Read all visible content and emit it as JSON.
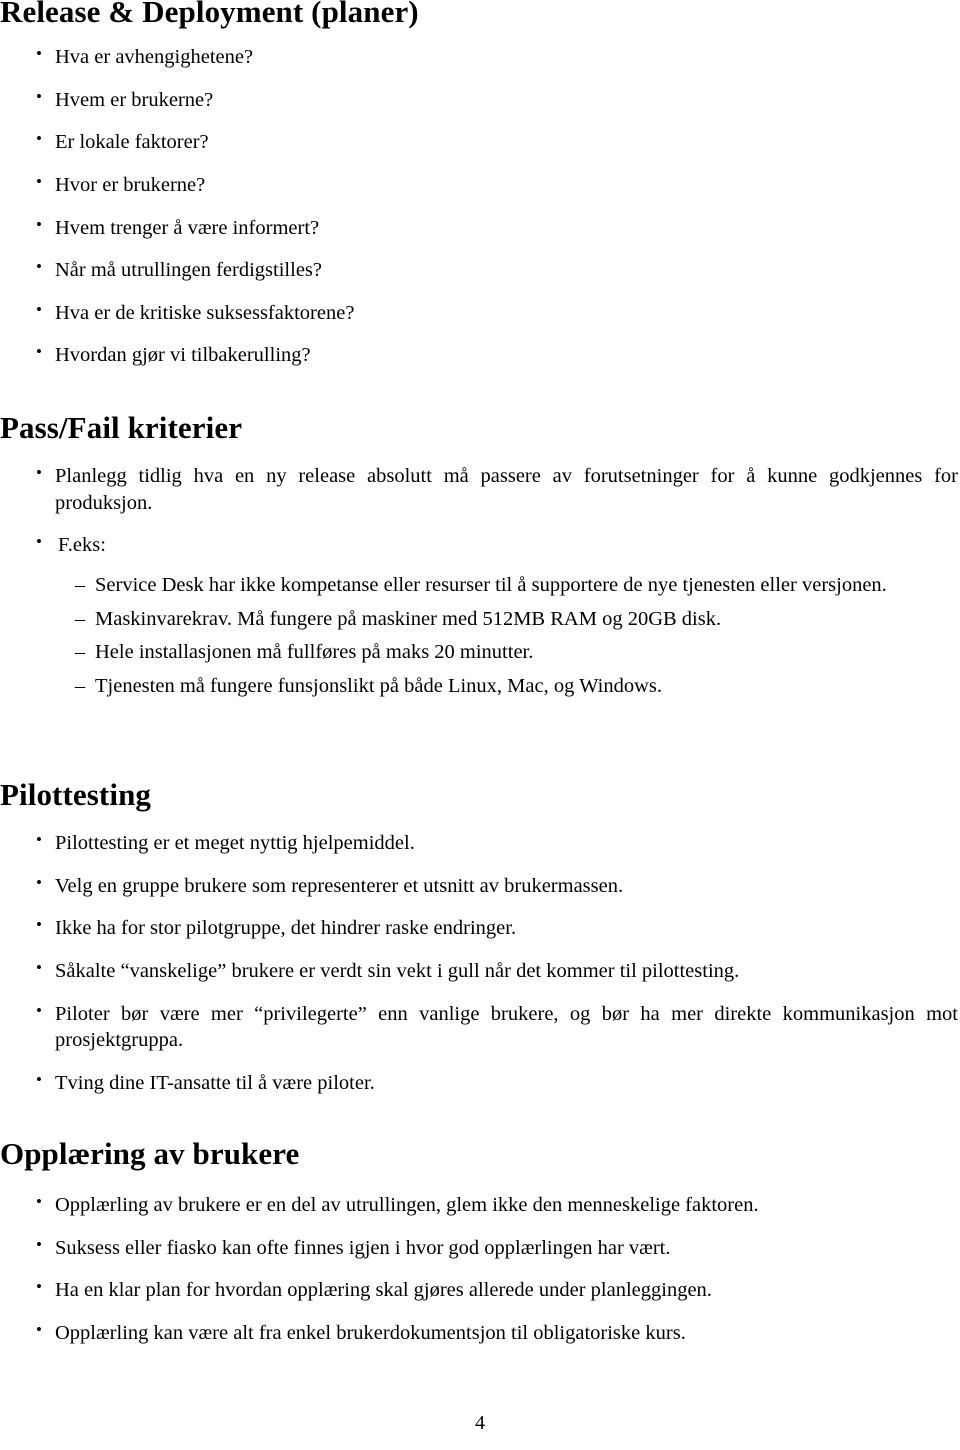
{
  "document": {
    "page_number": "4",
    "title": "Release & Deployment (planer)"
  },
  "intro_list": [
    "Hva er avhengighetene?",
    "Hvem er brukerne?",
    "Er lokale faktorer?",
    "Hvor er brukerne?",
    "Hvem trenger å være informert?",
    "Når må utrullingen ferdigstilles?",
    "Hva er de kritiske suksessfaktorene?",
    "Hvordan gjør vi tilbakerulling?"
  ],
  "passfail": {
    "heading": "Pass/Fail kriterier",
    "items": [
      "Planlegg tidlig hva en ny release absolutt må passere av forutsetninger for å kunne godkjennes for produksjon.",
      "F.eks:"
    ],
    "sub_items": [
      "Service Desk har ikke kompetanse eller resurser til å supportere de nye tjenesten eller versjonen.",
      "Maskinvarekrav. Må fungere på maskiner med 512MB RAM og 20GB disk.",
      "Hele installasjonen må fullføres på maks 20 minutter.",
      "Tjenesten må fungere funsjonslikt på både Linux, Mac, og Windows."
    ]
  },
  "pilottesting": {
    "heading": "Pilottesting",
    "items": [
      "Pilottesting er et meget nyttig hjelpemiddel.",
      "Velg en gruppe brukere som representerer et utsnitt av brukermassen.",
      "Ikke ha for stor pilotgruppe, det hindrer raske endringer.",
      "Såkalte “vanskelige” brukere er verdt sin vekt i gull når det kommer til pilottesting.",
      "Piloter bør være mer “privilegerte” enn vanlige brukere, og bør ha mer direkte kommunikasjon mot prosjektgruppa.",
      "Tving dine IT-ansatte til å være piloter."
    ]
  },
  "opplaering": {
    "heading": "Opplæring av brukere",
    "items": [
      "Opplærling av brukere er en del av utrullingen, glem ikke den menneskelige faktoren.",
      "Suksess eller fiasko kan ofte finnes igjen i hvor god opplærlingen har vært.",
      "Ha en klar plan for hvordan opplæring skal gjøres allerede under planleggingen.",
      "Opplærling kan være alt fra enkel brukerdokumentsjon til obligatoriske kurs."
    ]
  },
  "colors": {
    "page_background": "#ffffff",
    "text": "#000000"
  }
}
